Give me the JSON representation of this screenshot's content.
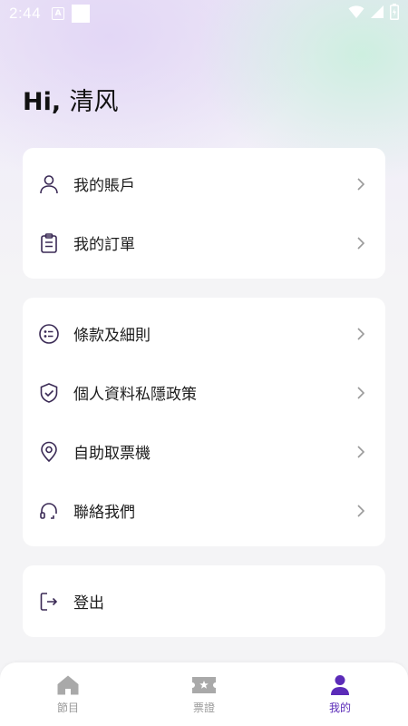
{
  "status_bar": {
    "time": "2:44",
    "a_badge": "A"
  },
  "greeting": {
    "prefix": "Hi,",
    "name": "清风"
  },
  "account_card": {
    "items": [
      {
        "label": "我的賬戶",
        "icon": "user-icon"
      },
      {
        "label": "我的訂單",
        "icon": "clipboard-icon"
      }
    ]
  },
  "info_card": {
    "items": [
      {
        "label": "條款及細則",
        "icon": "list-icon"
      },
      {
        "label": "個人資料私隱政策",
        "icon": "shield-check-icon"
      },
      {
        "label": "自助取票機",
        "icon": "location-pin-icon"
      },
      {
        "label": "聯絡我們",
        "icon": "headset-icon"
      }
    ]
  },
  "logout_card": {
    "label": "登出",
    "icon": "logout-icon"
  },
  "tabbar": {
    "tabs": [
      {
        "label": "節目",
        "icon": "home-icon",
        "active": false
      },
      {
        "label": "票證",
        "icon": "ticket-icon",
        "active": false
      },
      {
        "label": "我的",
        "icon": "profile-icon",
        "active": true
      }
    ]
  },
  "colors": {
    "accent": "#5b2bb8",
    "icon_dark": "#3a2a55",
    "inactive": "#9a9a9a",
    "card": "#ffffff",
    "background": "#f4f4f6"
  }
}
